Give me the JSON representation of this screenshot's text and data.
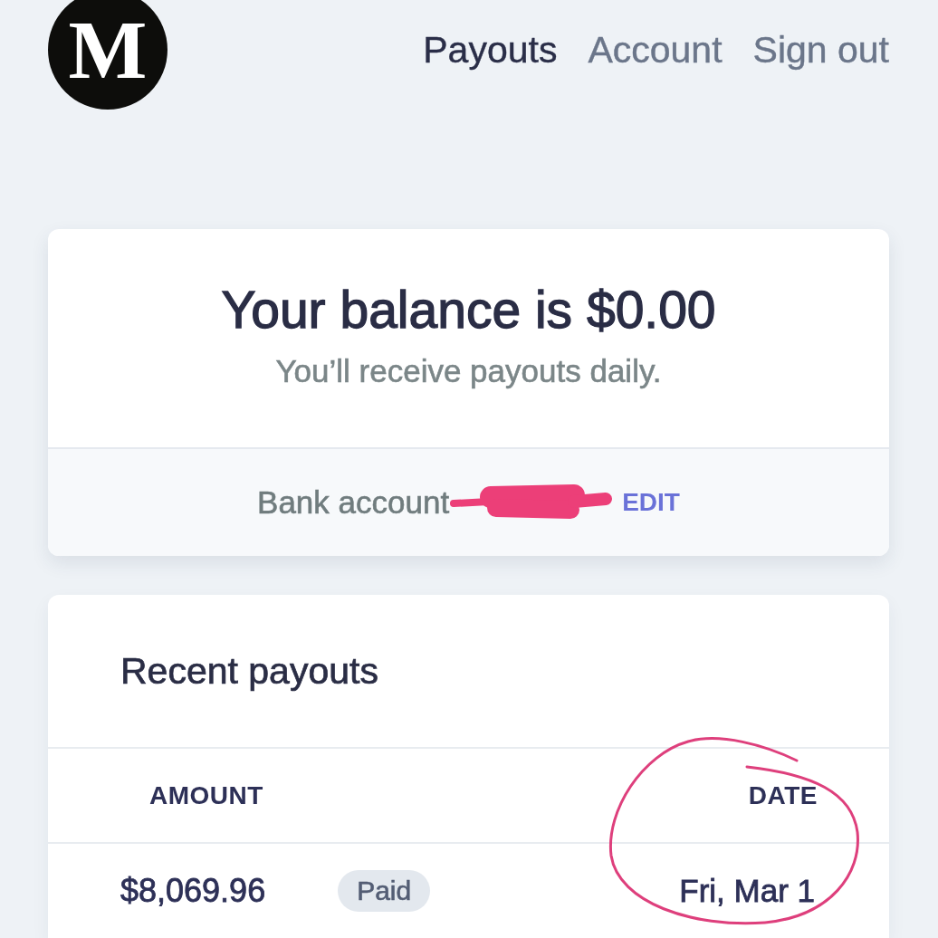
{
  "header": {
    "logo": {
      "letter": "M"
    },
    "nav": [
      {
        "label": "Payouts",
        "selected": true
      },
      {
        "label": "Account",
        "selected": false
      },
      {
        "label": "Sign out",
        "selected": false
      }
    ]
  },
  "balance_card": {
    "title": "Your balance is $0.00",
    "subtitle": "You’ll receive payouts daily.",
    "bank_account": {
      "label": "Bank account",
      "redacted": true,
      "action": "EDIT"
    }
  },
  "payouts_card": {
    "title": "Recent payouts",
    "table": {
      "columns": [
        {
          "label": "AMOUNT",
          "circled": false
        },
        {
          "label": "DATE",
          "circled": true
        }
      ],
      "rows": [
        {
          "amount": "$8,069.96",
          "status": "Paid",
          "date": "Fri, Mar 1"
        }
      ]
    }
  }
}
